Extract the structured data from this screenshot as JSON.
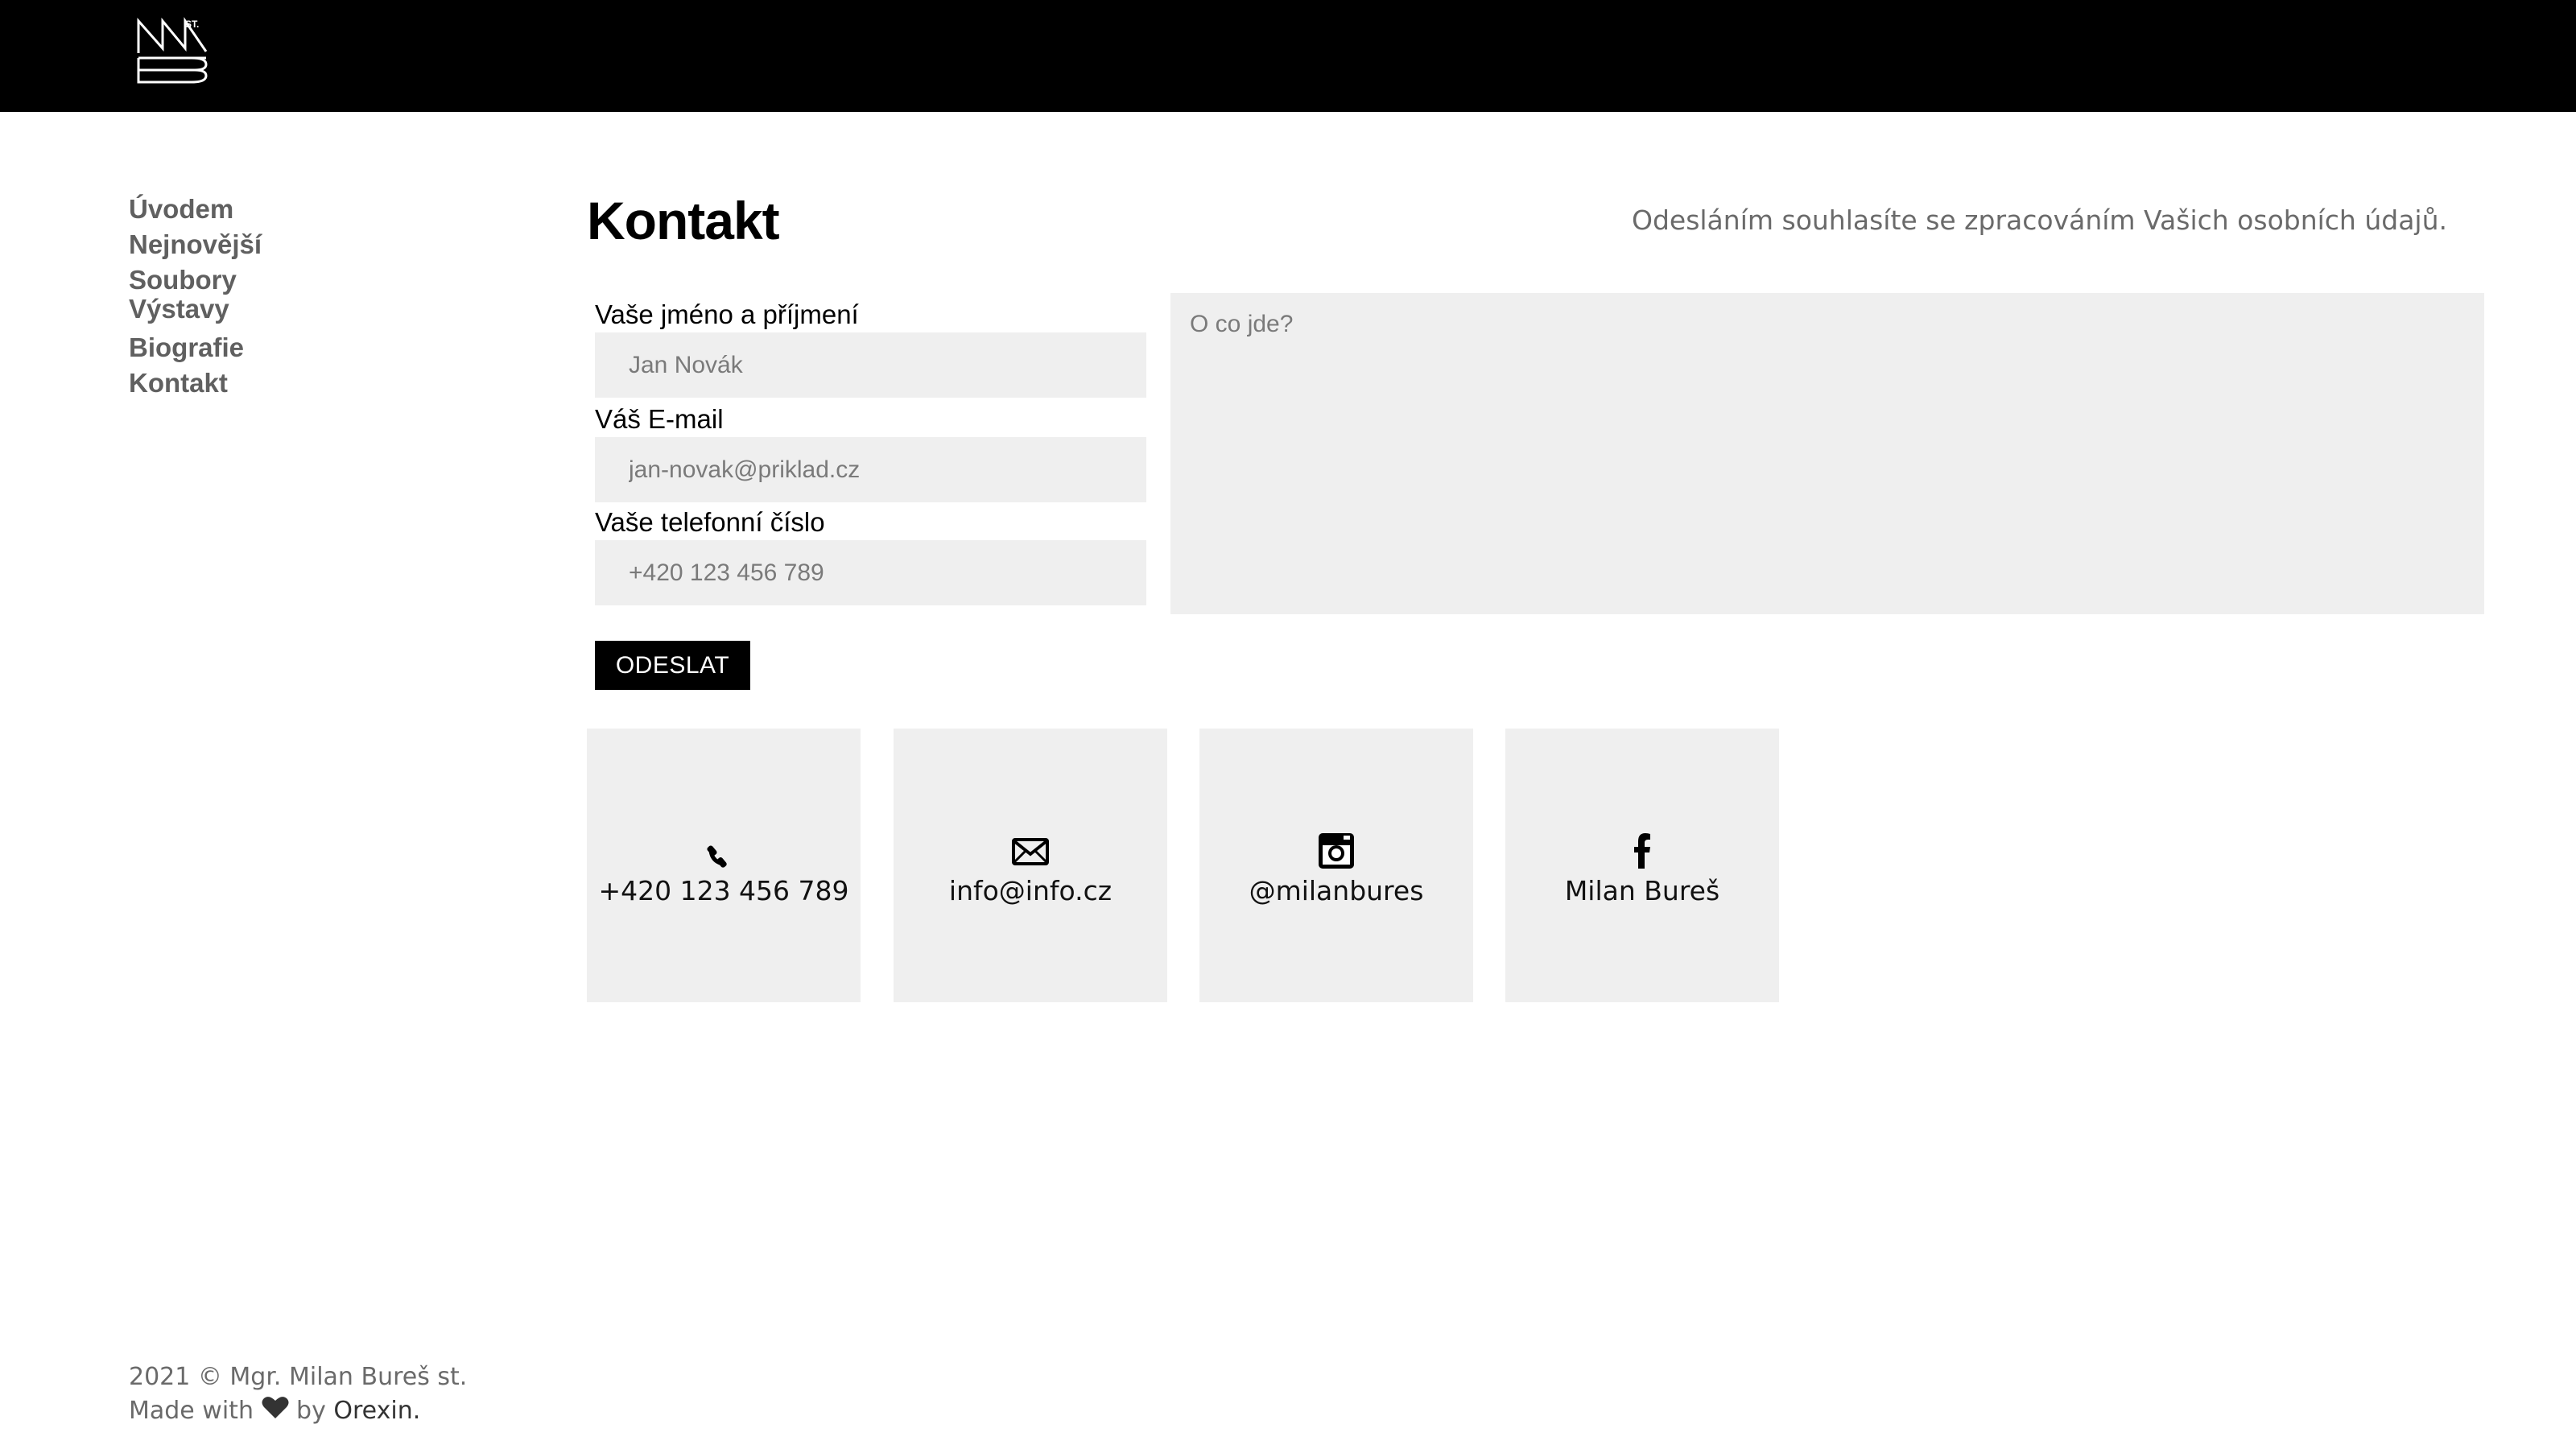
{
  "header": {
    "logo_text": "MB st."
  },
  "nav": {
    "items": [
      {
        "label": "Úvodem"
      },
      {
        "label": "Nejnovější"
      },
      {
        "label": "Soubory"
      },
      {
        "label": "Výstavy"
      },
      {
        "label": "Biografie"
      },
      {
        "label": "Kontakt"
      }
    ]
  },
  "page": {
    "title": "Kontakt",
    "consent_text": "Odesláním souhlasíte se zpracováním Vašich osobních údajů."
  },
  "form": {
    "name_label": "Vaše jméno a příjmení",
    "name_placeholder": "Jan Novák",
    "email_label": "Váš E-mail",
    "email_placeholder": "jan-novak@priklad.cz",
    "phone_label": "Vaše telefonní číslo",
    "phone_placeholder": "+420 123 456 789",
    "message_placeholder": "O co jde?",
    "submit_label": "ODESLAT"
  },
  "contact_cards": [
    {
      "icon": "phone-icon",
      "text": "+420 123 456 789"
    },
    {
      "icon": "envelope-icon",
      "text": "info@info.cz"
    },
    {
      "icon": "instagram-icon",
      "text": "@milanbures"
    },
    {
      "icon": "facebook-icon",
      "text": "Milan Bureš"
    }
  ],
  "footer": {
    "copyright": "2021 © Mgr. Milan Bureš st.",
    "made_with_prefix": "Made with",
    "made_with_by": "by",
    "made_with_author": "Orexin."
  },
  "colors": {
    "topbar": "#000000",
    "field_bg": "#efefef",
    "nav_text": "#606060",
    "muted_text": "#6a6a6a"
  }
}
